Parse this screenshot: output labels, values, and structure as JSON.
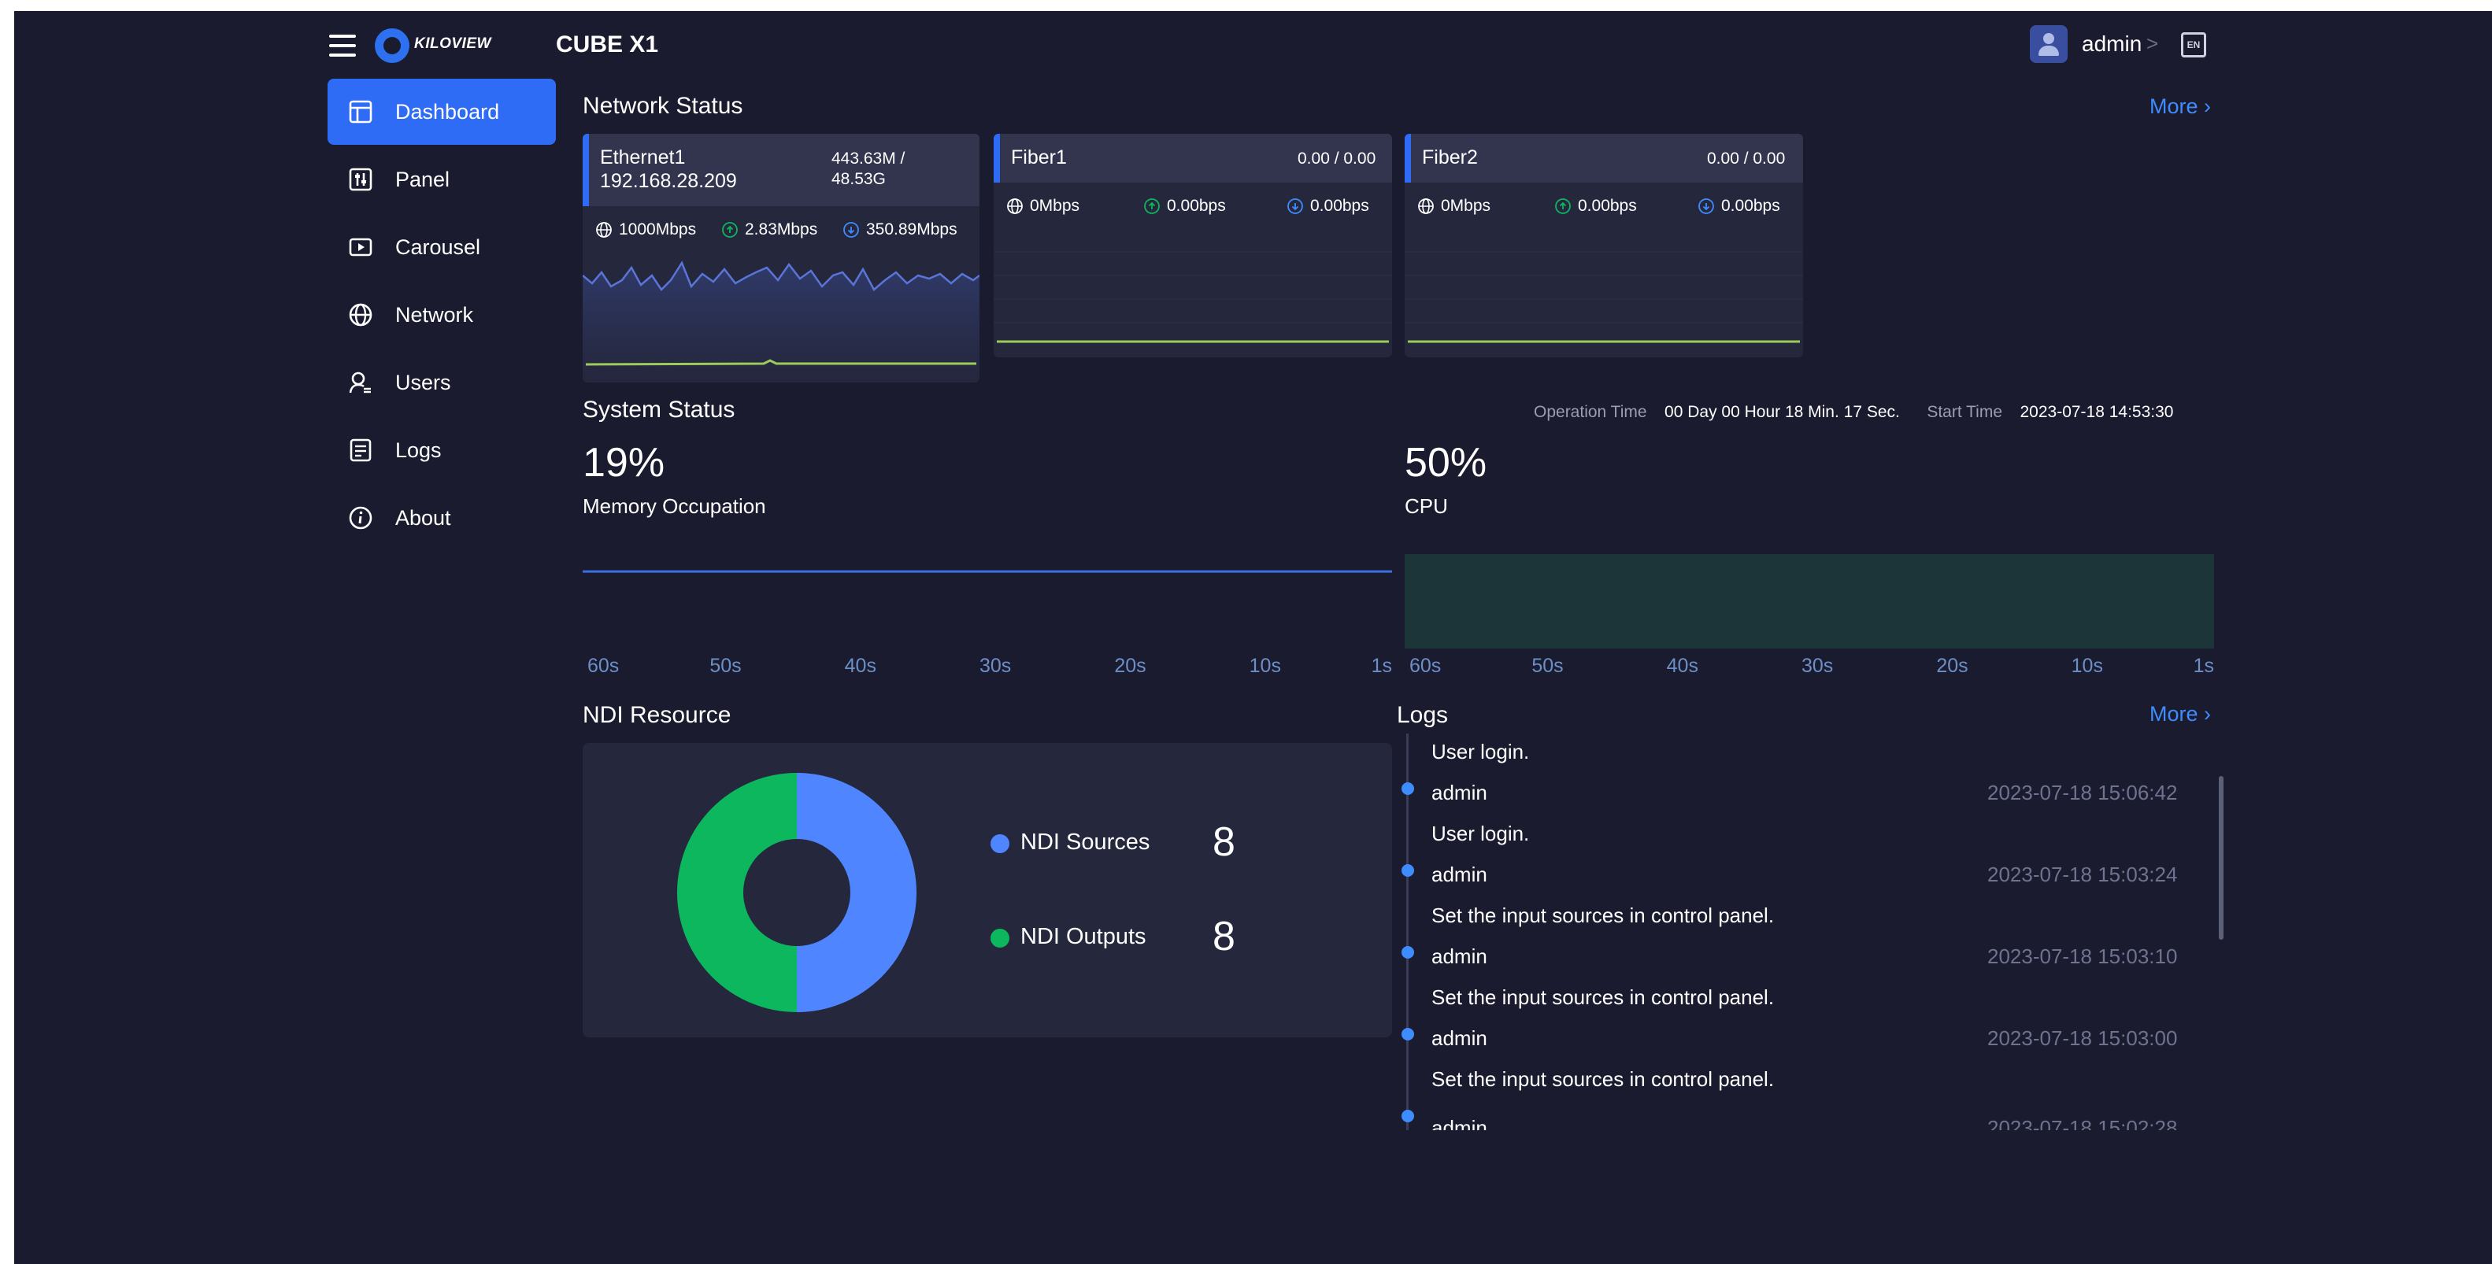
{
  "header": {
    "logo_text": "KILOVIEW",
    "app_title": "CUBE X1",
    "user": "admin",
    "user_chevron": ">",
    "lang_badge": "EN"
  },
  "sidebar": {
    "items": [
      {
        "label": "Dashboard",
        "icon": "dashboard-icon",
        "active": true
      },
      {
        "label": "Panel",
        "icon": "panel-icon",
        "active": false
      },
      {
        "label": "Carousel",
        "icon": "carousel-icon",
        "active": false
      },
      {
        "label": "Network",
        "icon": "globe-icon",
        "active": false
      },
      {
        "label": "Users",
        "icon": "users-icon",
        "active": false
      },
      {
        "label": "Logs",
        "icon": "logs-icon",
        "active": false
      },
      {
        "label": "About",
        "icon": "info-icon",
        "active": false
      }
    ]
  },
  "network_status": {
    "title": "Network Status",
    "more": "More",
    "cards": [
      {
        "name": "Ethernet1",
        "ip": "192.168.28.209",
        "traffic_line1": "443.63M /",
        "traffic_line2": "48.53G",
        "link_speed": "1000Mbps",
        "upload": "2.83Mbps",
        "download": "350.89Mbps"
      },
      {
        "name": "Fiber1",
        "ip": "",
        "traffic_line1": "0.00 / 0.00",
        "traffic_line2": "",
        "link_speed": "0Mbps",
        "upload": "0.00bps",
        "download": "0.00bps"
      },
      {
        "name": "Fiber2",
        "ip": "",
        "traffic_line1": "0.00 / 0.00",
        "traffic_line2": "",
        "link_speed": "0Mbps",
        "upload": "0.00bps",
        "download": "0.00bps"
      }
    ]
  },
  "system_status": {
    "title": "System Status",
    "operation_time_label": "Operation Time",
    "operation_time": "00 Day 00 Hour 18 Min. 17 Sec.",
    "start_time_label": "Start Time",
    "start_time": "2023-07-18 14:53:30",
    "memory_value": "19%",
    "memory_label": "Memory Occupation",
    "cpu_value": "50%",
    "cpu_label": "CPU",
    "ticks": [
      "60s",
      "50s",
      "40s",
      "30s",
      "20s",
      "10s",
      "1s"
    ]
  },
  "ndi_resource": {
    "title": "NDI Resource",
    "sources_label": "NDI Sources",
    "sources_count": "8",
    "outputs_label": "NDI Outputs",
    "outputs_count": "8"
  },
  "logs": {
    "title": "Logs",
    "more": "More",
    "top_message": "User login.",
    "entries": [
      {
        "user": "admin",
        "time": "2023-07-18 15:06:42",
        "message": "User login."
      },
      {
        "user": "admin",
        "time": "2023-07-18 15:03:24",
        "message": "Set the input sources in control panel."
      },
      {
        "user": "admin",
        "time": "2023-07-18 15:03:10",
        "message": "Set the input sources in control panel."
      },
      {
        "user": "admin",
        "time": "2023-07-18 15:03:00",
        "message": "Set the input sources in control panel."
      }
    ],
    "partial_user": "admin",
    "partial_time": "2023-07-18 15:02:28"
  },
  "colors": {
    "background": "#1a1b2e",
    "card": "#25273d",
    "accent_blue": "#2f6cf5",
    "link_blue": "#3f8cff",
    "green": "#0cb75e",
    "memory_line": "#3b6fe0",
    "cpu_line": "#1fbf6a",
    "idle_line": "#9ccc5a"
  },
  "chart_data": [
    {
      "type": "pie",
      "labels": [
        "NDI Sources",
        "NDI Outputs"
      ],
      "values": [
        8,
        8
      ],
      "title": "NDI Resource"
    },
    {
      "type": "line",
      "title": "Memory Occupation",
      "x": [
        "60s",
        "50s",
        "40s",
        "30s",
        "20s",
        "10s",
        "1s"
      ],
      "values": [
        19,
        19,
        19,
        19,
        19,
        19,
        19
      ],
      "ylim": [
        0,
        100
      ]
    },
    {
      "type": "area",
      "title": "CPU",
      "x": [
        "60s",
        "50s",
        "40s",
        "30s",
        "20s",
        "10s",
        "1s"
      ],
      "values": [
        50,
        50,
        48,
        50,
        50,
        51,
        50,
        52,
        50,
        49,
        50,
        51,
        52,
        50,
        51,
        50,
        52,
        48,
        50,
        51,
        52,
        50,
        51,
        49,
        50,
        52,
        50,
        49,
        51,
        50
      ],
      "ylim": [
        0,
        100
      ]
    }
  ]
}
